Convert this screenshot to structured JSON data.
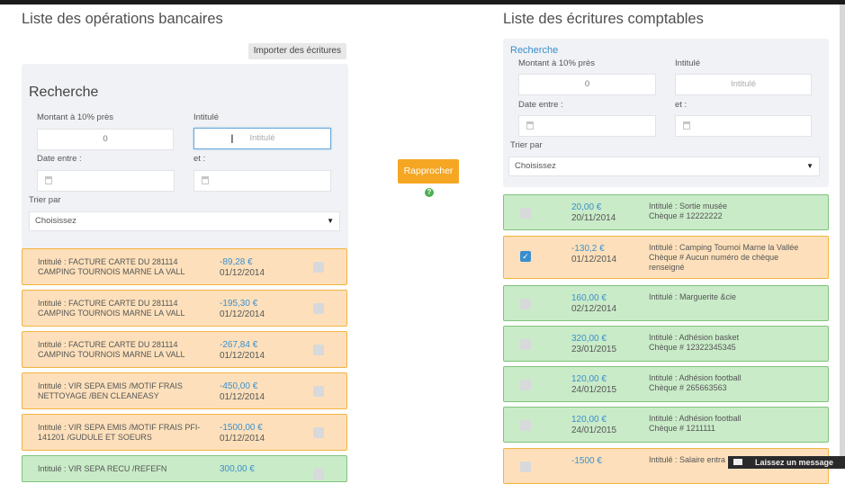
{
  "left": {
    "title": "Liste des opérations bancaires",
    "import_label": "Importer des écritures",
    "search": {
      "title": "Recherche",
      "amount_label": "Montant à 10% près",
      "amount_value": "0",
      "intitule_label": "Intitulé",
      "intitule_placeholder": "Intitulé",
      "date_label": "Date entre :",
      "and_label": "et :",
      "sort_label": "Trier par",
      "sort_value": "Choisissez"
    },
    "items": [
      {
        "label1": "Intitulé : FACTURE CARTE DU 281114",
        "label2": "CAMPING TOURNOIS MARNE LA VALL",
        "amount": "-89,28 €",
        "date": "01/12/2014",
        "status": "orange"
      },
      {
        "label1": "Intitulé : FACTURE CARTE DU 281114",
        "label2": "CAMPING TOURNOIS MARNE LA VALL",
        "amount": "-195,30 €",
        "date": "01/12/2014",
        "status": "orange"
      },
      {
        "label1": "Intitulé : FACTURE CARTE DU 281114",
        "label2": "CAMPING TOURNOIS MARNE LA VALL",
        "amount": "-267,84 €",
        "date": "01/12/2014",
        "status": "orange"
      },
      {
        "label1": "Intitulé : VIR SEPA EMIS /MOTIF FRAIS",
        "label2": "NETTOYAGE /BEN CLEANEASY",
        "amount": "-450,00 €",
        "date": "01/12/2014",
        "status": "orange"
      },
      {
        "label1": "Intitulé : VIR SEPA EMIS /MOTIF FRAIS PFI-",
        "label2": "141201 /GUDULE ET SOEURS",
        "amount": "-1500,00 €",
        "date": "01/12/2014",
        "status": "orange"
      },
      {
        "label1": "Intitulé : VIR SEPA RECU /REFEFN",
        "label2": "",
        "amount": "300,00 €",
        "date": "",
        "status": "green"
      }
    ]
  },
  "center": {
    "reconcile_label": "Rapprocher",
    "help_label": "?"
  },
  "right": {
    "title": "Liste des écritures comptables",
    "search": {
      "title": "Recherche",
      "amount_label": "Montant à 10% près",
      "amount_value": "0",
      "intitule_label": "Intitulé",
      "intitule_placeholder": "Intitulé",
      "date_label": "Date entre :",
      "and_label": "et :",
      "sort_label": "Trier par",
      "sort_value": "Choisissez"
    },
    "items": [
      {
        "amount": "20,00 €",
        "date": "20/11/2014",
        "line1": "Intitulé : Sortie musée",
        "line2": "Chèque # 12222222",
        "line3": "",
        "status": "green",
        "checked": false
      },
      {
        "amount": "-130,2 €",
        "date": "01/12/2014",
        "line1": "Intitulé : Camping Tournoi Marne la Vallée",
        "line2": "Chèque # Aucun numéro de chèque",
        "line3": "renseigné",
        "status": "orange",
        "checked": true
      },
      {
        "amount": "160,00 €",
        "date": "02/12/2014",
        "line1": "Intitulé : Marguerite &cie",
        "line2": "",
        "line3": "",
        "status": "green",
        "checked": false
      },
      {
        "amount": "320,00 €",
        "date": "23/01/2015",
        "line1": "Intitulé : Adhésion basket",
        "line2": "Chèque # 12322345345",
        "line3": "",
        "status": "green",
        "checked": false
      },
      {
        "amount": "120,00 €",
        "date": "24/01/2015",
        "line1": "Intitulé : Adhésion football",
        "line2": "Chèque # 265663563",
        "line3": "",
        "status": "green",
        "checked": false
      },
      {
        "amount": "120,00 €",
        "date": "24/01/2015",
        "line1": "Intitulé : Adhésion football",
        "line2": "Chèque # 1211111",
        "line3": "",
        "status": "green",
        "checked": false
      },
      {
        "amount": "-1500 €",
        "date": "",
        "line1": "Intitulé : Salaire entra",
        "line2": "",
        "line3": "",
        "status": "orange",
        "checked": false
      }
    ]
  },
  "chat": {
    "label": "Laissez un message",
    "icon": "envelope-icon"
  },
  "colors": {
    "orange_bg": "#fde0bb",
    "orange_border": "#f3b340",
    "green_bg": "#c9ebc8",
    "green_border": "#7fc47a",
    "accent": "#3d8fcc",
    "button": "#f5a623"
  }
}
